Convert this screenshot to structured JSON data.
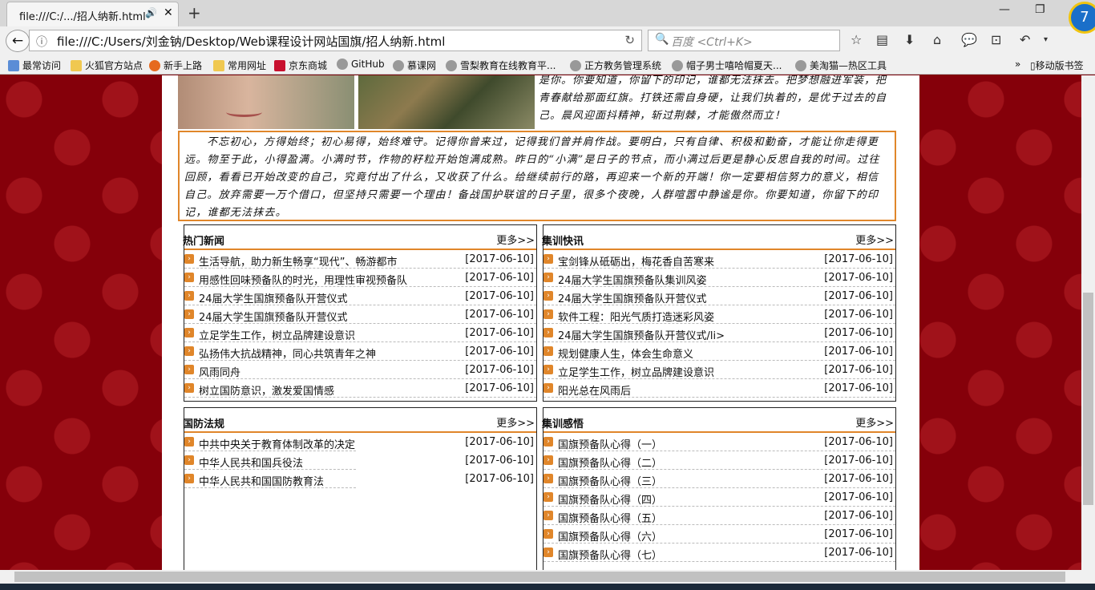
{
  "browser": {
    "tab_title": "file:///C:/.../招人纳新.html",
    "url": "file:///C:/Users/刘金钠/Desktop/Web课程设计网站国旗/招人纳新.html",
    "search_placeholder": "百度 <Ctrl+K>",
    "bookmarks": [
      "最常访问",
      "火狐官方站点",
      "新手上路",
      "常用网址",
      "京东商城",
      "GitHub",
      "慕课网",
      "雪梨教育在线教育平...",
      "正方教务管理系统",
      "帽子男士嘻哈帽夏天...",
      "美淘猫—热区工具"
    ],
    "bookmark_mobile": "移动版书签",
    "more_bookmarks": "»",
    "badge": "7"
  },
  "page": {
    "top_text": "是你。你要知道，你留下的印记，谁都无法抹去。把梦想融进军装，把青春献给那面红旗。打铁还需自身硬，让我们执着的，是优于过去的自己。晨风迎面抖精神，斩过荆棘，才能傲然而立！",
    "intro_text": "不忘初心，方得始终；初心易得，始终难守。记得你曾来过，记得我们曾并肩作战。要明白，只有自律、积极和勤奋，才能让你走得更远。物至于此，小得盈满。小满时节，作物的籽粒开始饱满成熟。昨日的“小满”是日子的节点，而小满过后更是静心反思自我的时间。过往回顾，看看已开始改变的自己，究竟付出了什么，又收获了什么。给继续前行的路，再迎来一个新的开端！你一定要相信努力的意义，相信自己。放弃需要一万个借口，但坚持只需要一个理由！备战国护联谊的日子里，很多个夜晚，人群喧嚣中静谧是你。你要知道，你留下的印记，谁都无法抹去。",
    "more_label": "更多>>",
    "panels": [
      {
        "title": "热门新闻",
        "items": [
          {
            "t": "生活导航，助力新生畅享“现代”、畅游都市",
            "d": "[2017-06-10]"
          },
          {
            "t": "用感性回味预备队的时光，用理性审视预备队",
            "d": "[2017-06-10]"
          },
          {
            "t": "24届大学生国旗预备队开营仪式",
            "d": "[2017-06-10]"
          },
          {
            "t": "24届大学生国旗预备队开营仪式",
            "d": "[2017-06-10]"
          },
          {
            "t": "立足学生工作，树立品牌建设意识",
            "d": "[2017-06-10]"
          },
          {
            "t": "弘扬伟大抗战精神，同心共筑青年之神",
            "d": "[2017-06-10]"
          },
          {
            "t": "风雨同舟",
            "d": "[2017-06-10]"
          },
          {
            "t": "树立国防意识，激发爱国情感",
            "d": "[2017-06-10]"
          }
        ]
      },
      {
        "title": "集训快讯",
        "items": [
          {
            "t": "宝剑锋从砥砺出，梅花香自苦寒来",
            "d": "[2017-06-10]"
          },
          {
            "t": "24届大学生国旗预备队集训风姿",
            "d": "[2017-06-10]"
          },
          {
            "t": "24届大学生国旗预备队开营仪式",
            "d": "[2017-06-10]"
          },
          {
            "t": "软件工程：阳光气质打造迷彩风姿",
            "d": "[2017-06-10]"
          },
          {
            "t": "24届大学生国旗预备队开营仪式/li>",
            "d": "[2017-06-10]"
          },
          {
            "t": "规划健康人生，体会生命意义",
            "d": "[2017-06-10]"
          },
          {
            "t": "立足学生工作，树立品牌建设意识",
            "d": "[2017-06-10]"
          },
          {
            "t": "阳光总在风雨后",
            "d": "[2017-06-10]"
          }
        ]
      },
      {
        "title": "国防法规",
        "items": [
          {
            "t": "中共中央关于教育体制改革的决定",
            "d": "[2017-06-10]"
          },
          {
            "t": "中华人民共和国兵役法",
            "d": "[2017-06-10]"
          },
          {
            "t": "中华人民共和国国防教育法",
            "d": "[2017-06-10]"
          }
        ]
      },
      {
        "title": "集训感悟",
        "items": [
          {
            "t": "国旗预备队心得（一）",
            "d": "[2017-06-10]"
          },
          {
            "t": "国旗预备队心得（二）",
            "d": "[2017-06-10]"
          },
          {
            "t": "国旗预备队心得（三）",
            "d": "[2017-06-10]"
          },
          {
            "t": "国旗预备队心得（四）",
            "d": "[2017-06-10]"
          },
          {
            "t": "国旗预备队心得（五）",
            "d": "[2017-06-10]"
          },
          {
            "t": "国旗预备队心得（六）",
            "d": "[2017-06-10]"
          },
          {
            "t": "国旗预备队心得（七）",
            "d": "[2017-06-10]"
          }
        ]
      }
    ]
  }
}
